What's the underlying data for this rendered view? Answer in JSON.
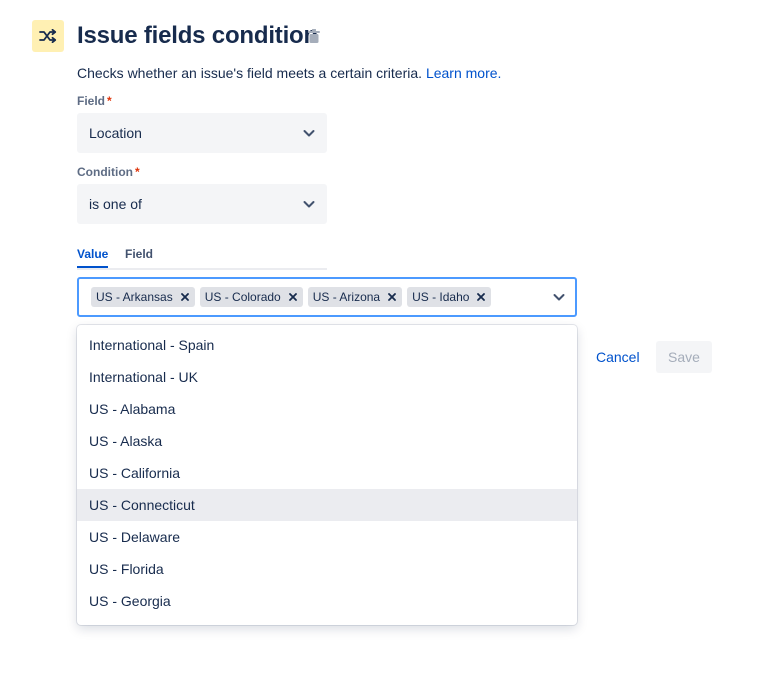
{
  "header": {
    "icon": "shuffle-icon",
    "title": "Issue fields condition",
    "delete_icon": "trash-icon",
    "description": "Checks whether an issue's field meets a certain criteria.",
    "learn_more": "Learn more."
  },
  "field": {
    "label": "Field",
    "required_mark": "*",
    "value": "Location"
  },
  "condition": {
    "label": "Condition",
    "required_mark": "*",
    "value": "is one of"
  },
  "tabs": [
    {
      "label": "Value",
      "active": true
    },
    {
      "label": "Field",
      "active": false
    }
  ],
  "value_select": {
    "chips": [
      "US - Arkansas",
      "US - Colorado",
      "US - Arizona",
      "US - Idaho"
    ]
  },
  "dropdown": {
    "options": [
      "International - Spain",
      "International - UK",
      "US - Alabama",
      "US - Alaska",
      "US - California",
      "US - Connecticut",
      "US - Delaware",
      "US - Florida",
      "US - Georgia"
    ],
    "highlighted": "US - Connecticut"
  },
  "actions": {
    "cancel": "Cancel",
    "save": "Save"
  },
  "colors": {
    "accent": "#0052cc",
    "focus_border": "#4c9aff",
    "icon_bg": "#fff0b3",
    "required": "#de350b"
  }
}
